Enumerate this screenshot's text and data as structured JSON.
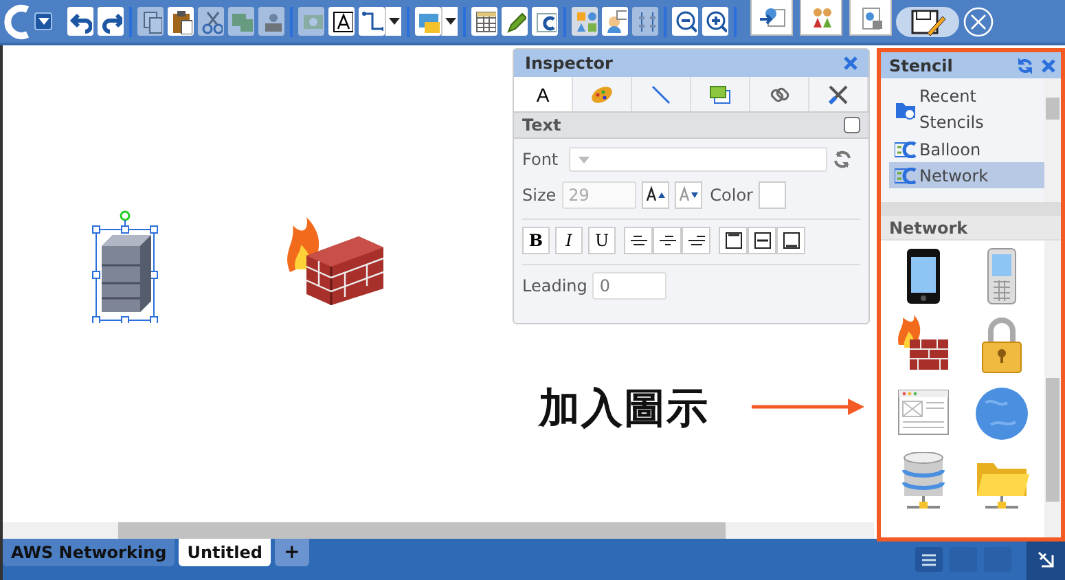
{
  "toolbar": {
    "buttons": [
      {
        "disabled": false
      },
      {
        "disabled": false
      },
      {
        "disabled": true
      },
      {
        "disabled": false
      },
      {
        "disabled": true
      },
      {
        "disabled": true
      },
      {
        "disabled": true
      },
      {
        "disabled": true
      },
      {
        "disabled": false
      },
      {
        "disabled": false
      },
      {
        "disabled": false
      },
      {
        "disabled": false
      },
      {
        "disabled": false
      },
      {
        "disabled": false
      },
      {
        "disabled": false
      },
      {
        "disabled": false
      },
      {
        "disabled": true
      },
      {
        "disabled": false
      },
      {
        "disabled": false
      }
    ]
  },
  "inspector": {
    "title": "Inspector",
    "tabs": [
      {
        "label": "A",
        "selected": true
      },
      {
        "selected": false
      },
      {
        "selected": false
      },
      {
        "selected": false
      },
      {
        "selected": false
      },
      {
        "selected": false
      }
    ],
    "section": {
      "title": "Text",
      "checked": false
    },
    "font": {
      "label": "Font"
    },
    "size": {
      "label": "Size",
      "value": "29",
      "disabled": true
    },
    "color": {
      "label": "Color"
    },
    "styles": [
      {
        "label": "B"
      },
      {
        "label": "I"
      },
      {
        "label": "U"
      }
    ],
    "leading": {
      "label": "Leading",
      "placeholder": "0"
    }
  },
  "stencil": {
    "title": "Stencil",
    "tree": [
      {
        "label": "Recent Stencils",
        "kind": "folder",
        "selected": false
      },
      {
        "label": "Balloon",
        "kind": "stencil",
        "selected": false
      },
      {
        "label": "Network",
        "kind": "stencil",
        "selected": true
      }
    ],
    "section_title": "Network"
  },
  "canvas": {
    "annotation": "加入圖示"
  },
  "tabs": [
    {
      "label": "AWS Networking",
      "selected": false
    },
    {
      "label": "Untitled",
      "selected": true
    }
  ],
  "add_tab": {
    "label": "+"
  }
}
